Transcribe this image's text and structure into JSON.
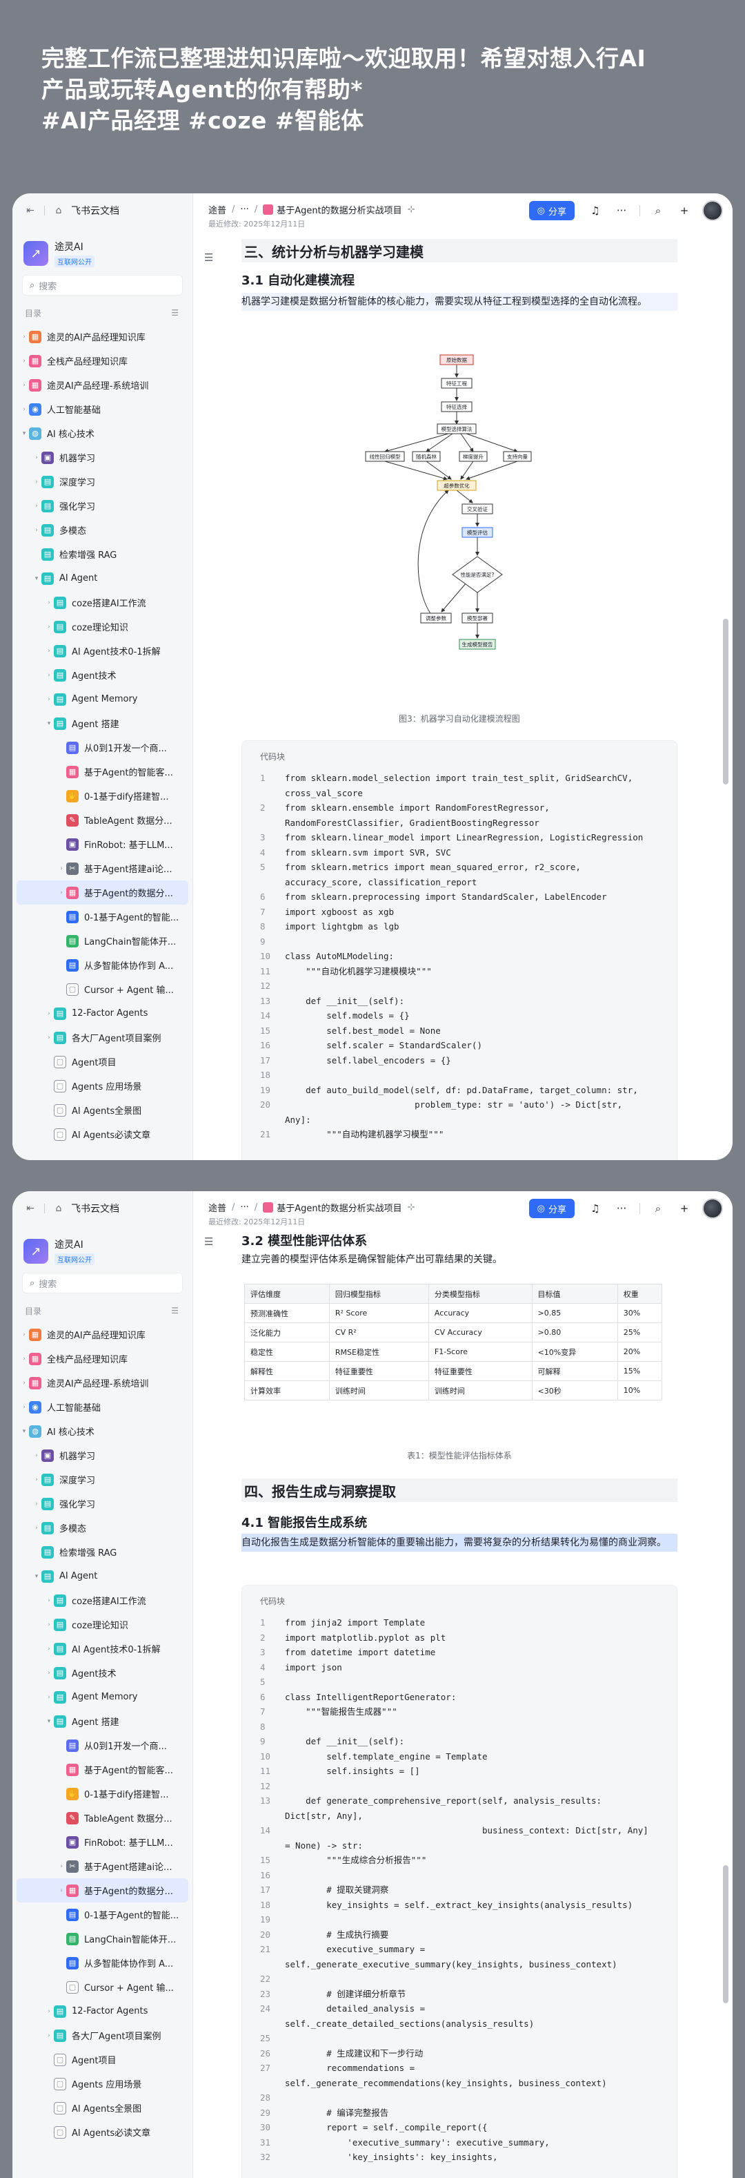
{
  "banner": {
    "lines": [
      "完整工作流已整理进知识库啦～欢迎取用！希望对想入行AI",
      "产品或玩转Agent的你有帮助*",
      "#AI产品经理 #coze #智能体"
    ]
  },
  "sidebar": {
    "app_name": "飞书云文档",
    "space_name": "途灵AI",
    "space_badge": "互联网公开",
    "search_placeholder": "搜索",
    "toc_label": "目录",
    "items": [
      {
        "label": "途灵的AI产品经理知识库",
        "color": "#f07b3f",
        "glyph": "▦"
      },
      {
        "label": "全栈产品经理知识库",
        "color": "#f0608f",
        "glyph": "▦"
      },
      {
        "label": "途灵AI产品经理-系统培训",
        "color": "#f0608f",
        "glyph": "▦"
      },
      {
        "label": "人工智能基础",
        "color": "#3d82f5",
        "glyph": "◉"
      },
      {
        "label": "AI 核心技术",
        "color": "#5ab4e0",
        "glyph": "◍"
      },
      {
        "label": "机器学习",
        "color": "#6a4fa3",
        "glyph": "▣"
      },
      {
        "label": "深度学习",
        "color": "#2cc3c3",
        "glyph": "▤"
      },
      {
        "label": "强化学习",
        "color": "#2cc3c3",
        "glyph": "▤"
      },
      {
        "label": "多模态",
        "color": "#2cc3c3",
        "glyph": "▤"
      },
      {
        "label": "检索增强 RAG",
        "color": "#2cc3c3",
        "glyph": "▤"
      },
      {
        "label": "AI Agent",
        "color": "#2cc3c3",
        "glyph": "▤"
      },
      {
        "label": "coze搭建AI工作流",
        "color": "#2cc3c3",
        "glyph": "▤"
      },
      {
        "label": "coze理论知识",
        "color": "#2cc3c3",
        "glyph": "▤"
      },
      {
        "label": "AI Agent技术0-1拆解",
        "color": "#2cc3c3",
        "glyph": "▤"
      },
      {
        "label": "Agent技术",
        "color": "#2cc3c3",
        "glyph": "▤"
      },
      {
        "label": "Agent Memory",
        "color": "#2cc3c3",
        "glyph": "▤"
      },
      {
        "label": "Agent 搭建",
        "color": "#2cc3c3",
        "glyph": "▤"
      },
      {
        "label": "从0到1开发一个商...",
        "color": "#5b6cf0",
        "glyph": "▤"
      },
      {
        "label": "基于Agent的智能客...",
        "color": "#f0608f",
        "glyph": "▦"
      },
      {
        "label": "0-1基于dify搭建智...",
        "color": "#f5a623",
        "glyph": "✋"
      },
      {
        "label": "TableAgent 数据分...",
        "color": "#e04f5f",
        "glyph": "✎"
      },
      {
        "label": "FinRobot: 基于LLM...",
        "color": "#6a4fa3",
        "glyph": "▣"
      },
      {
        "label": "基于Agent搭建ai论...",
        "color": "#6b7280",
        "glyph": "✂"
      },
      {
        "label": "基于Agent的数据分...",
        "color": "#f0608f",
        "glyph": "▦"
      },
      {
        "label": "0-1基于Agent的智能...",
        "color": "#2f6bf6",
        "glyph": "▤"
      },
      {
        "label": "LangChain智能体开...",
        "color": "#34b36b",
        "glyph": "▤"
      },
      {
        "label": "从多智能体协作到 A...",
        "color": "#2f6bf6",
        "glyph": "▤"
      },
      {
        "label": "Cursor + Agent 输...",
        "color": "#ffffff",
        "glyph": "▢"
      },
      {
        "label": "12-Factor Agents",
        "color": "#2cc3c3",
        "glyph": "▤"
      },
      {
        "label": "各大厂Agent项目案例",
        "color": "#2cc3c3",
        "glyph": "▤"
      },
      {
        "label": "Agent项目",
        "color": "#ffffff",
        "glyph": "▢"
      },
      {
        "label": "Agents 应用场景",
        "color": "#ffffff",
        "glyph": "▢"
      },
      {
        "label": "AI Agents全景图",
        "color": "#ffffff",
        "glyph": "▢"
      },
      {
        "label": "AI Agents必读文章",
        "color": "#ffffff",
        "glyph": "▢"
      }
    ]
  },
  "header": {
    "crumb_root": "途普",
    "crumb_ellipsis": "···",
    "doc_title": "基于Agent的数据分析实战项目",
    "last_edited": "最近修改: 2025年12月11日",
    "share_label": "分享"
  },
  "page1": {
    "section_title": "三、统计分析与机器学习建模",
    "subsection_title": "3.1 自动化建模流程",
    "intro": "机器学习建模是数据分析智能体的核心能力，需要实现从特征工程到模型选择的全自动化流程。",
    "figure_caption": "图3：机器学习自动化建模流程图",
    "code_label": "代码块",
    "code": [
      {
        "n": "1",
        "t": "from sklearn.model_selection import train_test_split, GridSearchCV,"
      },
      {
        "n": "",
        "t": "cross_val_score"
      },
      {
        "n": "2",
        "t": "from sklearn.ensemble import RandomForestRegressor,"
      },
      {
        "n": "",
        "t": "RandomForestClassifier, GradientBoostingRegressor"
      },
      {
        "n": "3",
        "t": "from sklearn.linear_model import LinearRegression, LogisticRegression"
      },
      {
        "n": "4",
        "t": "from sklearn.svm import SVR, SVC"
      },
      {
        "n": "5",
        "t": "from sklearn.metrics import mean_squared_error, r2_score,"
      },
      {
        "n": "",
        "t": "accuracy_score, classification_report"
      },
      {
        "n": "6",
        "t": "from sklearn.preprocessing import StandardScaler, LabelEncoder"
      },
      {
        "n": "7",
        "t": "import xgboost as xgb"
      },
      {
        "n": "8",
        "t": "import lightgbm as lgb"
      },
      {
        "n": "9",
        "t": ""
      },
      {
        "n": "10",
        "t": "class AutoMLModeling:"
      },
      {
        "n": "11",
        "t": "    \"\"\"自动化机器学习建模模块\"\"\""
      },
      {
        "n": "12",
        "t": ""
      },
      {
        "n": "13",
        "t": "    def __init__(self):"
      },
      {
        "n": "14",
        "t": "        self.models = {}"
      },
      {
        "n": "15",
        "t": "        self.best_model = None"
      },
      {
        "n": "16",
        "t": "        self.scaler = StandardScaler()"
      },
      {
        "n": "17",
        "t": "        self.label_encoders = {}"
      },
      {
        "n": "18",
        "t": ""
      },
      {
        "n": "19",
        "t": "    def auto_build_model(self, df: pd.DataFrame, target_column: str,"
      },
      {
        "n": "20",
        "t": "                         problem_type: str = 'auto') -> Dict[str,"
      },
      {
        "n": "",
        "t": "Any]:"
      },
      {
        "n": "21",
        "t": "        \"\"\"自动构建机器学习模型\"\"\""
      }
    ]
  },
  "flowchart": {
    "nodes": [
      "原始数据",
      "特征工程",
      "特征选择",
      "模型选择算法",
      "线性回归模型",
      "随机森林",
      "梯度提升",
      "支持向量",
      "超参数优化",
      "交叉验证",
      "模型评估",
      "性能是否满足?",
      "调整参数",
      "模型部署",
      "生成模型报告"
    ]
  },
  "page2": {
    "subsection_title": "3.2 模型性能评估体系",
    "intro": "建立完善的模型评估体系是确保智能体产出可靠结果的关键。",
    "table": [
      [
        "评估维度",
        "回归模型指标",
        "分类模型指标",
        "目标值",
        "权重"
      ],
      [
        "预测准确性",
        "R² Score",
        "Accuracy",
        ">0.85",
        "30%"
      ],
      [
        "泛化能力",
        "CV R²",
        "CV Accuracy",
        ">0.80",
        "25%"
      ],
      [
        "稳定性",
        "RMSE稳定性",
        "F1-Score",
        "<10%变异",
        "20%"
      ],
      [
        "解释性",
        "特征重要性",
        "特征重要性",
        "可解释",
        "15%"
      ],
      [
        "计算效率",
        "训练时间",
        "训练时间",
        "<30秒",
        "10%"
      ]
    ],
    "table_caption": "表1：模型性能评估指标体系",
    "section_title": "四、报告生成与洞察提取",
    "subsection2_title": "4.1 智能报告生成系统",
    "intro2": "自动化报告生成是数据分析智能体的重要输出能力，需要将复杂的分析结果转化为易懂的商业洞察。",
    "code_label": "代码块",
    "code": [
      {
        "n": "1",
        "t": "from jinja2 import Template"
      },
      {
        "n": "2",
        "t": "import matplotlib.pyplot as plt"
      },
      {
        "n": "3",
        "t": "from datetime import datetime"
      },
      {
        "n": "4",
        "t": "import json"
      },
      {
        "n": "5",
        "t": ""
      },
      {
        "n": "6",
        "t": "class IntelligentReportGenerator:"
      },
      {
        "n": "7",
        "t": "    \"\"\"智能报告生成器\"\"\""
      },
      {
        "n": "8",
        "t": ""
      },
      {
        "n": "9",
        "t": "    def __init__(self):"
      },
      {
        "n": "10",
        "t": "        self.template_engine = Template"
      },
      {
        "n": "11",
        "t": "        self.insights = []"
      },
      {
        "n": "12",
        "t": ""
      },
      {
        "n": "13",
        "t": "    def generate_comprehensive_report(self, analysis_results:"
      },
      {
        "n": "",
        "t": "Dict[str, Any],"
      },
      {
        "n": "14",
        "t": "                                      business_context: Dict[str, Any]"
      },
      {
        "n": "",
        "t": "= None) -> str:"
      },
      {
        "n": "15",
        "t": "        \"\"\"生成综合分析报告\"\"\""
      },
      {
        "n": "16",
        "t": ""
      },
      {
        "n": "17",
        "t": "        # 提取关键洞察"
      },
      {
        "n": "18",
        "t": "        key_insights = self._extract_key_insights(analysis_results)"
      },
      {
        "n": "19",
        "t": ""
      },
      {
        "n": "20",
        "t": "        # 生成执行摘要"
      },
      {
        "n": "21",
        "t": "        executive_summary ="
      },
      {
        "n": "",
        "t": "self._generate_executive_summary(key_insights, business_context)"
      },
      {
        "n": "22",
        "t": ""
      },
      {
        "n": "23",
        "t": "        # 创建详细分析章节"
      },
      {
        "n": "24",
        "t": "        detailed_analysis ="
      },
      {
        "n": "",
        "t": "self._create_detailed_sections(analysis_results)"
      },
      {
        "n": "25",
        "t": ""
      },
      {
        "n": "26",
        "t": "        # 生成建议和下一步行动"
      },
      {
        "n": "27",
        "t": "        recommendations ="
      },
      {
        "n": "",
        "t": "self._generate_recommendations(key_insights, business_context)"
      },
      {
        "n": "28",
        "t": ""
      },
      {
        "n": "29",
        "t": "        # 编译完整报告"
      },
      {
        "n": "30",
        "t": "        report = self._compile_report({"
      },
      {
        "n": "31",
        "t": "            'executive_summary': executive_summary,"
      },
      {
        "n": "32",
        "t": "            'key_insights': key_insights,"
      }
    ]
  }
}
